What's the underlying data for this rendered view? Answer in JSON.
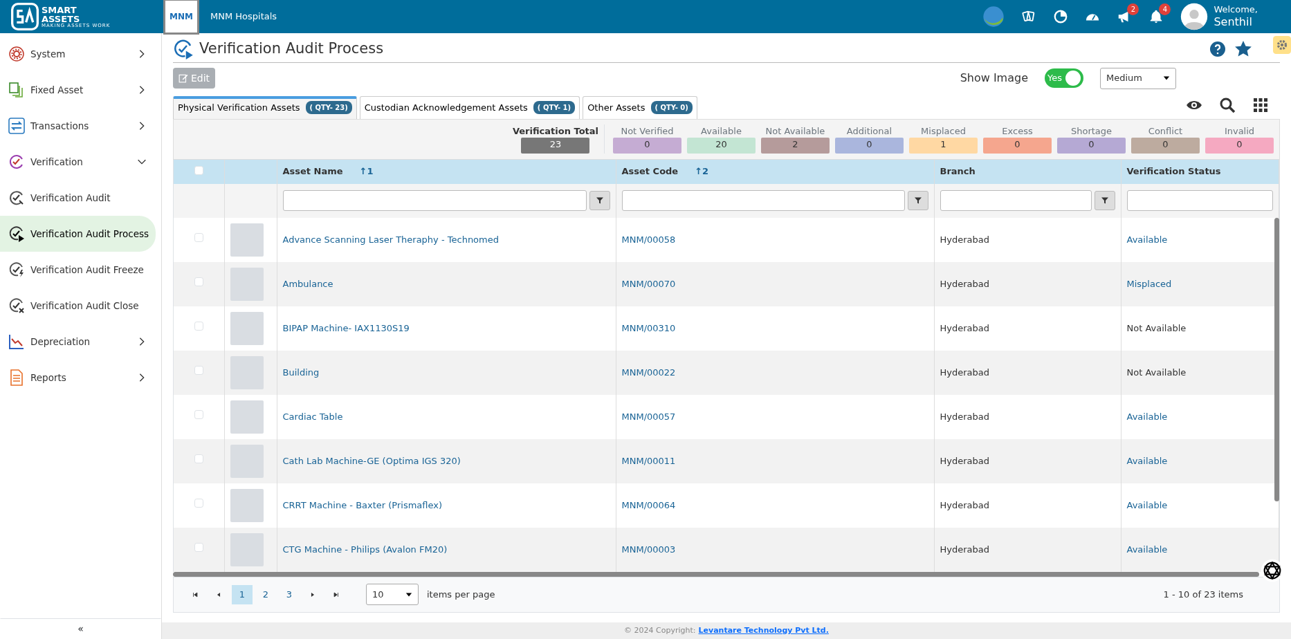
{
  "brand": {
    "name": "SMART",
    "name_2": "ASSETS",
    "tagline": "MAKING ASSETS WORK"
  },
  "org": {
    "name": "MNM Hospitals",
    "logo_text": "MNM"
  },
  "topbar": {
    "icons": [
      {
        "kind": "globe"
      },
      {
        "kind": "cards"
      },
      {
        "kind": "pie"
      },
      {
        "kind": "gauge"
      },
      {
        "kind": "megaphone",
        "badge": "2"
      },
      {
        "kind": "bell",
        "badge": "4"
      }
    ],
    "welcome": "Welcome,",
    "user": "Senthil"
  },
  "sidebar": {
    "items": [
      {
        "label": "System",
        "expanded": false,
        "selected": false
      },
      {
        "label": "Fixed Asset",
        "expanded": false,
        "selected": false
      },
      {
        "label": "Transactions",
        "expanded": false,
        "selected": false
      },
      {
        "label": "Verification",
        "expanded": true,
        "selected": false,
        "children": [
          {
            "label": "Verification Audit",
            "selected": false
          },
          {
            "label": "Verification Audit Process",
            "selected": true
          },
          {
            "label": "Verification Audit Freeze",
            "selected": false
          },
          {
            "label": "Verification Audit Close",
            "selected": false
          }
        ]
      },
      {
        "label": "Depreciation",
        "expanded": false,
        "selected": false
      },
      {
        "label": "Reports",
        "expanded": false,
        "selected": false
      }
    ],
    "collapse": "«"
  },
  "page": {
    "title": "Verification Audit Process",
    "edit": {
      "label": "Edit",
      "disabled": true
    },
    "show_image": {
      "label": "Show Image",
      "on": true,
      "on_text": "Yes"
    },
    "image_size": "Medium"
  },
  "tabs": [
    {
      "label": "Physical Verification Assets",
      "qty": "( QTY- 23)",
      "selected": true
    },
    {
      "label": "Custodian Acknowledgement Assets",
      "qty": "( QTY- 1)",
      "selected": false
    },
    {
      "label": "Other Assets",
      "qty": "( QTY- 0)",
      "selected": false
    }
  ],
  "summary": {
    "total": {
      "label": "Verification Total",
      "value": "23"
    },
    "counts": [
      {
        "label": "Not Verified",
        "value": "0",
        "color": "#c5acd3"
      },
      {
        "label": "Available",
        "value": "20",
        "color": "#c3e5d3"
      },
      {
        "label": "Not Available",
        "value": "2",
        "color": "#b59b9b"
      },
      {
        "label": "Additional",
        "value": "0",
        "color": "#aab6dd"
      },
      {
        "label": "Misplaced",
        "value": "1",
        "color": "#ffd8a3"
      },
      {
        "label": "Excess",
        "value": "0",
        "color": "#f5a68e"
      },
      {
        "label": "Shortage",
        "value": "0",
        "color": "#b5a9d4"
      },
      {
        "label": "Conflict",
        "value": "0",
        "color": "#bdab9f"
      },
      {
        "label": "Invalid",
        "value": "0",
        "color": "#f5a9c1"
      }
    ]
  },
  "table": {
    "all_checked": false,
    "columns": [
      {
        "label": "Asset Name",
        "sort": "↑1",
        "filter": true
      },
      {
        "label": "Asset Code",
        "sort": "↑2",
        "filter": true
      },
      {
        "label": "Branch",
        "filter": true
      },
      {
        "label": "Verification Status",
        "filter": false
      }
    ],
    "rows": [
      {
        "name": "Advance Scanning Laser Theraphy - Technomed",
        "code": "MNM/00058",
        "branch": "Hyderabad",
        "status": "Available",
        "status_link": true,
        "checked": false
      },
      {
        "name": "Ambulance",
        "code": "MNM/00070",
        "branch": "Hyderabad",
        "status": "Misplaced",
        "status_link": true,
        "checked": false
      },
      {
        "name": "BIPAP Machine- IAX1130S19",
        "code": "MNM/00310",
        "branch": "Hyderabad",
        "status": "Not Available",
        "status_link": false,
        "checked": false
      },
      {
        "name": "Building",
        "code": "MNM/00022",
        "branch": "Hyderabad",
        "status": "Not Available",
        "status_link": false,
        "checked": false
      },
      {
        "name": "Cardiac Table",
        "code": "MNM/00057",
        "branch": "Hyderabad",
        "status": "Available",
        "status_link": true,
        "checked": false
      },
      {
        "name": "Cath Lab Machine-GE (Optima IGS 320)",
        "code": "MNM/00011",
        "branch": "Hyderabad",
        "status": "Available",
        "status_link": true,
        "checked": false
      },
      {
        "name": "CRRT Machine - Baxter (Prismaflex)",
        "code": "MNM/00064",
        "branch": "Hyderabad",
        "status": "Available",
        "status_link": true,
        "checked": false
      },
      {
        "name": "CTG Machine - Philips (Avalon FM20)",
        "code": "MNM/00003",
        "branch": "Hyderabad",
        "status": "Available",
        "status_link": true,
        "checked": false
      }
    ]
  },
  "pager": {
    "pages": [
      {
        "label": "1",
        "selected": true
      },
      {
        "label": "2",
        "selected": false
      },
      {
        "label": "3",
        "selected": false
      }
    ],
    "page_size": "10",
    "per_page": "items per page",
    "range": "1 - 10 of 23 items"
  },
  "footer": {
    "text": "© 2024 Copyright:",
    "link": "Levantare Technology Pvt Ltd."
  }
}
